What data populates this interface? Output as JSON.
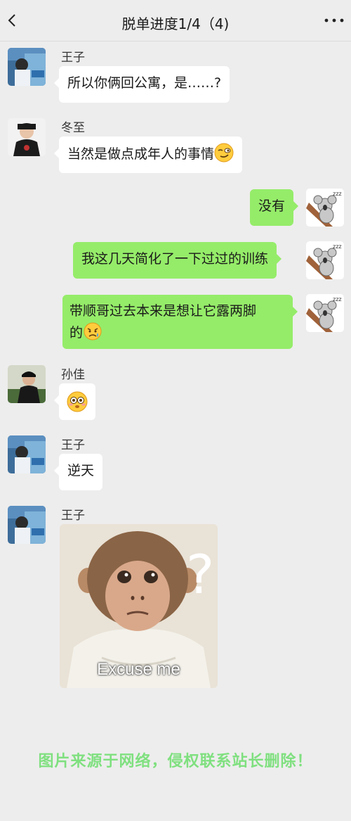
{
  "header": {
    "title": "脱单进度1/4（4)",
    "back_icon": "chevron-left-icon",
    "more_icon": "more-horizontal-icon"
  },
  "messages": [
    {
      "side": "left",
      "sender": "王子",
      "text": "所以你俩回公寓，是……?"
    },
    {
      "side": "left",
      "sender": "冬至",
      "text": "当然是做点成年人的事情",
      "emoji": "smirk-emoji"
    },
    {
      "side": "right",
      "text": "没有"
    },
    {
      "side": "right",
      "text": "我这几天简化了一下过过的训练"
    },
    {
      "side": "right",
      "text_line1": "带顺哥过去本来是想让它露两脚",
      "text_line2": "的",
      "emoji": "sad-emoji"
    },
    {
      "side": "left",
      "sender": "孙佳",
      "emoji": "flushed-emoji"
    },
    {
      "side": "left",
      "sender": "王子",
      "text": "逆天"
    },
    {
      "side": "left",
      "sender": "王子",
      "sticker": "confused-monkey-sticker",
      "sticker_caption": "Excuse me"
    }
  ],
  "watermark": "图片来源于网络，侵权联系站长删除！",
  "colors": {
    "background": "#ededed",
    "bubble_left": "#ffffff",
    "bubble_right": "#95ec69",
    "watermark": "#7fe07f"
  }
}
